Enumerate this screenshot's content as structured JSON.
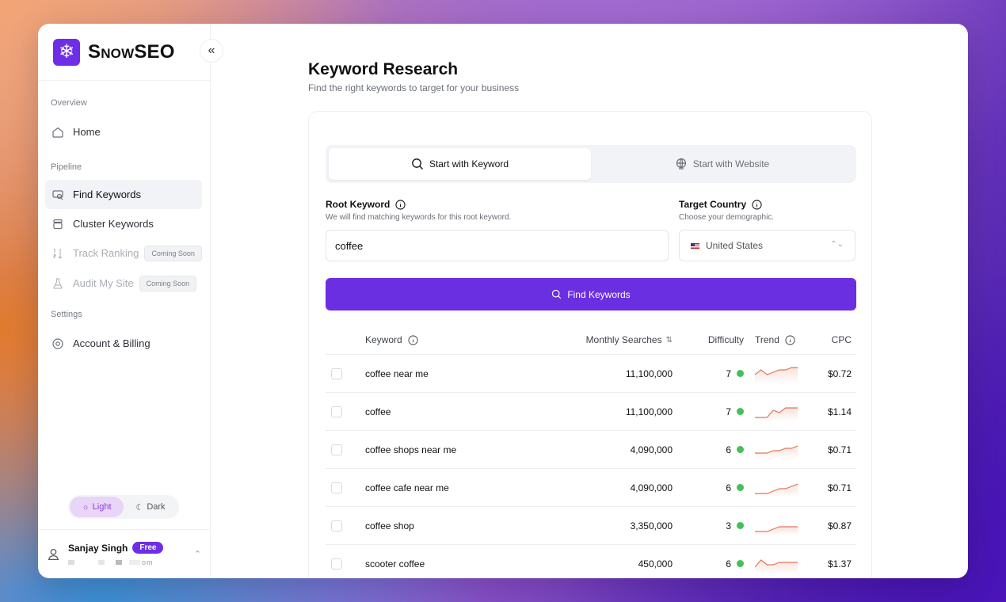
{
  "brand": {
    "name": "SnowSEO"
  },
  "sidebar": {
    "sections": [
      {
        "title": "Overview"
      },
      {
        "title": "Pipeline"
      },
      {
        "title": "Settings"
      }
    ],
    "items": [
      {
        "label": "Home"
      },
      {
        "label": "Find Keywords"
      },
      {
        "label": "Cluster Keywords"
      },
      {
        "label": "Track Ranking",
        "badge": "Coming Soon"
      },
      {
        "label": "Audit My Site",
        "badge": "Coming Soon"
      },
      {
        "label": "Account & Billing"
      }
    ],
    "theme": {
      "light": "Light",
      "dark": "Dark",
      "selected": "Light"
    }
  },
  "user": {
    "name": "Sanjay Singh",
    "plan": "Free",
    "email_suffix": "om"
  },
  "page": {
    "title": "Keyword Research",
    "subtitle": "Find the right keywords to target for your business"
  },
  "tabs": [
    {
      "label": "Start with Keyword",
      "active": true
    },
    {
      "label": "Start with Website",
      "active": false
    }
  ],
  "form": {
    "root_label": "Root Keyword",
    "root_hint": "We will find matching keywords for this root keyword.",
    "root_value": "coffee",
    "country_label": "Target Country",
    "country_hint": "Choose your demographic.",
    "country_value": "United States",
    "submit_label": "Find Keywords"
  },
  "table": {
    "headers": {
      "keyword": "Keyword",
      "searches": "Monthly Searches",
      "difficulty": "Difficulty",
      "trend": "Trend",
      "cpc": "CPC"
    },
    "rows": [
      {
        "keyword": "coffee near me",
        "searches": "11,100,000",
        "difficulty": "7",
        "cpc": "$0.72",
        "trend": [
          3,
          5,
          3,
          4,
          5,
          5,
          6,
          6
        ]
      },
      {
        "keyword": "coffee",
        "searches": "11,100,000",
        "difficulty": "7",
        "cpc": "$1.14",
        "trend": [
          1,
          1,
          1,
          4,
          3,
          5,
          5,
          5
        ]
      },
      {
        "keyword": "coffee shops near me",
        "searches": "4,090,000",
        "difficulty": "6",
        "cpc": "$0.71",
        "trend": [
          2,
          2,
          2,
          3,
          3,
          4,
          4,
          5
        ]
      },
      {
        "keyword": "coffee cafe near me",
        "searches": "4,090,000",
        "difficulty": "6",
        "cpc": "$0.71",
        "trend": [
          1,
          1,
          1,
          2,
          3,
          3,
          4,
          5
        ]
      },
      {
        "keyword": "coffee shop",
        "searches": "3,350,000",
        "difficulty": "3",
        "cpc": "$0.87",
        "trend": [
          1,
          1,
          1,
          2,
          3,
          3,
          3,
          3
        ]
      },
      {
        "keyword": "scooter coffee",
        "searches": "450,000",
        "difficulty": "6",
        "cpc": "$1.37",
        "trend": [
          2,
          5,
          3,
          3,
          4,
          4,
          4,
          4
        ]
      }
    ]
  },
  "colors": {
    "accent": "#6a2fe0",
    "difficulty_dot": "#43c15a",
    "trend_line": "#e0785a"
  }
}
